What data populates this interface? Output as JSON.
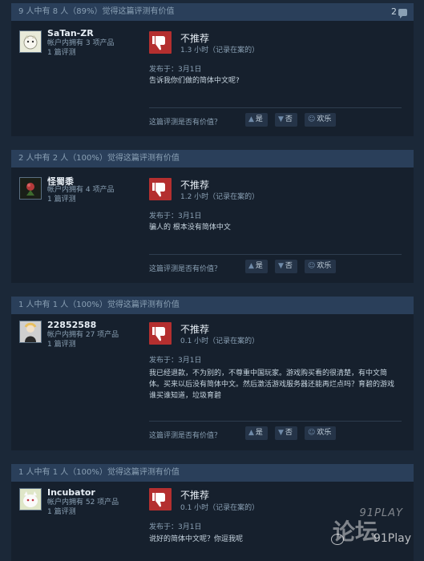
{
  "reviews": [
    {
      "helpful": "9 人中有 8 人（89%）觉得这篇评测有价值",
      "comments": "2",
      "user": "SaTan-ZR",
      "products": "帐户内拥有 3 项产品",
      "review_count": "1 篇评测",
      "verdict": "不推荐",
      "hours": "1.3 小时（记录在案的）",
      "posted": "发布于：3月1日",
      "text": "告诉我你们做的简体中文呢?",
      "vote_question": "这篇评测是否有价值？",
      "yes": "是",
      "no": "否",
      "funny": "欢乐"
    },
    {
      "helpful": "2 人中有 2 人（100%）觉得这篇评测有价值",
      "user": "怪蜀黍",
      "products": "帐户内拥有 4 项产品",
      "review_count": "1 篇评测",
      "verdict": "不推荐",
      "hours": "1.2 小时（记录在案的）",
      "posted": "发布于：3月1日",
      "text": "骗人的 根本没有简体中文",
      "vote_question": "这篇评测是否有价值？",
      "yes": "是",
      "no": "否",
      "funny": "欢乐"
    },
    {
      "helpful": "1 人中有 1 人（100%）觉得这篇评测有价值",
      "user": "22852588",
      "products": "帐户内拥有 27 项产品",
      "review_count": "1 篇评测",
      "verdict": "不推荐",
      "hours": "0.1 小时（记录在案的）",
      "posted": "发布于：3月1日",
      "text": "我已经退款，不为别的，不尊重中国玩家。游戏购买看的很清楚，有中文简体。买来以后没有简体中文。然后激活游戏服务器还能再烂点吗？育碧的游戏谁买谁知道，垃圾育碧",
      "vote_question": "这篇评测是否有价值？",
      "yes": "是",
      "no": "否",
      "funny": "欢乐"
    },
    {
      "helpful": "1 人中有 1 人（100%）觉得这篇评测有价值",
      "user": "Incubator",
      "products": "帐户内拥有 52 项产品",
      "review_count": "1 篇评测",
      "verdict": "不推荐",
      "hours": "0.1 小时（记录在案的）",
      "posted": "发布于：3月1日",
      "text": "说好的简体中文呢？你逗我呢"
    }
  ],
  "watermark": {
    "top": "91PLAY",
    "big": "论坛",
    "brand": "91Play"
  },
  "icons": {
    "thumb_down": "thumbs-down-icon",
    "vote_yes": "thumbs-up-icon",
    "vote_no": "thumbs-down-icon",
    "funny": "smiley-icon",
    "comments": "comment-bubble-icon"
  }
}
